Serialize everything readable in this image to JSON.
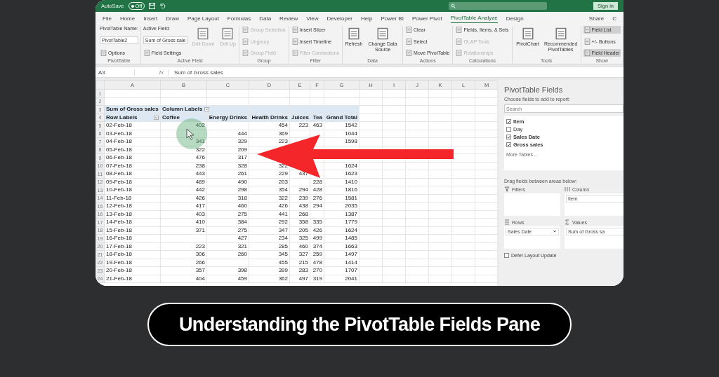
{
  "titlebar": {
    "autosave_label": "AutoSave",
    "autosave_state": "Off",
    "sign_in": "Sign in"
  },
  "tabs": [
    {
      "label": "File",
      "selected": false
    },
    {
      "label": "Home",
      "selected": false
    },
    {
      "label": "Insert",
      "selected": false
    },
    {
      "label": "Draw",
      "selected": false
    },
    {
      "label": "Page Layout",
      "selected": false
    },
    {
      "label": "Formulas",
      "selected": false
    },
    {
      "label": "Data",
      "selected": false
    },
    {
      "label": "Review",
      "selected": false
    },
    {
      "label": "View",
      "selected": false
    },
    {
      "label": "Developer",
      "selected": false
    },
    {
      "label": "Help",
      "selected": false
    },
    {
      "label": "Power BI",
      "selected": false
    },
    {
      "label": "Power Pivot",
      "selected": false
    },
    {
      "label": "PivotTable Analyze",
      "selected": true
    },
    {
      "label": "Design",
      "selected": false
    }
  ],
  "tab_actions": [
    "Share",
    "C"
  ],
  "ribbon": [
    {
      "label": "PivotTable",
      "items": [
        {
          "kind": "label",
          "text": "PivotTable Name:"
        },
        {
          "kind": "input",
          "text": "PivotTable2"
        },
        {
          "kind": "small",
          "text": "Options",
          "disabled": false
        }
      ]
    },
    {
      "label": "Active Field",
      "items": [
        {
          "kind": "label",
          "text": "Active Field:"
        },
        {
          "kind": "input",
          "text": "Sum of Gross sale"
        },
        {
          "kind": "small",
          "text": "Field Settings",
          "disabled": false
        },
        {
          "kind": "large",
          "text": "Drill Down",
          "disabled": true
        },
        {
          "kind": "large",
          "text": "Drill Up",
          "disabled": true
        }
      ]
    },
    {
      "label": "Group",
      "items": [
        {
          "kind": "small",
          "text": "Group Selection",
          "disabled": true
        },
        {
          "kind": "small",
          "text": "Ungroup",
          "disabled": true
        },
        {
          "kind": "small",
          "text": "Group Field",
          "disabled": true
        }
      ]
    },
    {
      "label": "Filter",
      "items": [
        {
          "kind": "small",
          "text": "Insert Slicer",
          "disabled": false
        },
        {
          "kind": "small",
          "text": "Insert Timeline",
          "disabled": false
        },
        {
          "kind": "small",
          "text": "Filter Connections",
          "disabled": true
        }
      ]
    },
    {
      "label": "Data",
      "items": [
        {
          "kind": "large",
          "text": "Refresh",
          "disabled": false
        },
        {
          "kind": "large",
          "text": "Change Data Source",
          "disabled": false
        }
      ]
    },
    {
      "label": "Actions",
      "items": [
        {
          "kind": "small",
          "text": "Clear",
          "disabled": false
        },
        {
          "kind": "small",
          "text": "Select",
          "disabled": false
        },
        {
          "kind": "small",
          "text": "Move PivotTable",
          "disabled": false
        }
      ]
    },
    {
      "label": "Calculations",
      "items": [
        {
          "kind": "small",
          "text": "Fields, Items, & Sets",
          "disabled": false
        },
        {
          "kind": "small",
          "text": "OLAP Tools",
          "disabled": true
        },
        {
          "kind": "small",
          "text": "Relationships",
          "disabled": true
        }
      ]
    },
    {
      "label": "Tools",
      "items": [
        {
          "kind": "large",
          "text": "PivotChart",
          "disabled": false
        },
        {
          "kind": "large",
          "text": "Recommended PivotTables",
          "disabled": false
        }
      ]
    },
    {
      "label": "Show",
      "items": [
        {
          "kind": "small",
          "text": "Field List",
          "disabled": false,
          "selected": true
        },
        {
          "kind": "small",
          "text": "+/- Buttons",
          "disabled": false,
          "selected": false
        },
        {
          "kind": "small",
          "text": "Field Header",
          "disabled": false,
          "selected": true
        }
      ]
    }
  ],
  "formula_bar": {
    "name_box": "A3",
    "fx_label": "fx",
    "formula": "Sum of Gross sales"
  },
  "sheet": {
    "columns": [
      "A",
      "B",
      "C",
      "D",
      "E",
      "F",
      "G",
      "H",
      "I",
      "J",
      "K",
      "L",
      "M"
    ],
    "rows": [
      {
        "number": "1",
        "kind": "blank",
        "cells": []
      },
      {
        "number": "2",
        "kind": "blank",
        "cells": []
      },
      {
        "number": "3",
        "kind": "pivot_header",
        "cells": [
          "Sum of Gross sales",
          "Column Labels"
        ]
      },
      {
        "number": "4",
        "kind": "pivot_labels",
        "cells": [
          "Row Labels",
          "Coffee",
          "Energy Drinks",
          "Health Drinks",
          "Juices",
          "Tea",
          "Grand Total"
        ]
      },
      {
        "number": "5",
        "kind": "data",
        "cells": [
          "02-Feb-18",
          "402",
          null,
          "454",
          "223",
          "463",
          "1542"
        ]
      },
      {
        "number": "6",
        "kind": "data",
        "cells": [
          "03-Feb-18",
          null,
          "444",
          "369",
          null,
          null,
          "1044"
        ]
      },
      {
        "number": "7",
        "kind": "data",
        "cells": [
          "04-Feb-18",
          "341",
          "329",
          "223",
          null,
          null,
          "1598"
        ]
      },
      {
        "number": "8",
        "kind": "data",
        "cells": [
          "05-Feb-18",
          "322",
          "209",
          null,
          null,
          null,
          null
        ]
      },
      {
        "number": "9",
        "kind": "data",
        "cells": [
          "06-Feb-18",
          "476",
          "317",
          null,
          null,
          null,
          null
        ]
      },
      {
        "number": "10",
        "kind": "data",
        "cells": [
          "07-Feb-18",
          "238",
          "328",
          "322",
          null,
          null,
          "1624"
        ]
      },
      {
        "number": "11",
        "kind": "data",
        "cells": [
          "08-Feb-18",
          "443",
          "261",
          "229",
          "437",
          null,
          "1623"
        ]
      },
      {
        "number": "12",
        "kind": "data",
        "cells": [
          "09-Feb-18",
          "489",
          "490",
          "203",
          null,
          "228",
          "1410"
        ]
      },
      {
        "number": "13",
        "kind": "data",
        "cells": [
          "10-Feb-18",
          "442",
          "298",
          "354",
          "294",
          "428",
          "1816"
        ]
      },
      {
        "number": "14",
        "kind": "data",
        "cells": [
          "11-Feb-18",
          "426",
          "318",
          "322",
          "239",
          "276",
          "1581"
        ]
      },
      {
        "number": "15",
        "kind": "data",
        "cells": [
          "12-Feb-18",
          "417",
          "460",
          "426",
          "438",
          "294",
          "2035"
        ]
      },
      {
        "number": "16",
        "kind": "data",
        "cells": [
          "13-Feb-18",
          "403",
          "275",
          "441",
          "268",
          null,
          "1387"
        ]
      },
      {
        "number": "17",
        "kind": "data",
        "cells": [
          "14-Feb-18",
          "410",
          "384",
          "292",
          "358",
          "335",
          "1779"
        ]
      },
      {
        "number": "18",
        "kind": "data",
        "cells": [
          "15-Feb-18",
          "371",
          "275",
          "347",
          "205",
          "426",
          "1624"
        ]
      },
      {
        "number": "19",
        "kind": "data",
        "cells": [
          "16-Feb-18",
          null,
          "427",
          "234",
          "325",
          "499",
          "1485"
        ]
      },
      {
        "number": "20",
        "kind": "data",
        "cells": [
          "17-Feb-18",
          "223",
          "321",
          "285",
          "460",
          "374",
          "1663"
        ]
      },
      {
        "number": "21",
        "kind": "data",
        "cells": [
          "18-Feb-18",
          "306",
          "260",
          "345",
          "327",
          "259",
          "1497"
        ]
      },
      {
        "number": "22",
        "kind": "data",
        "cells": [
          "19-Feb-18",
          "266",
          null,
          "455",
          "215",
          "478",
          "1414"
        ]
      },
      {
        "number": "23",
        "kind": "data",
        "cells": [
          "20-Feb-18",
          "357",
          "398",
          "399",
          "283",
          "270",
          "1707"
        ]
      },
      {
        "number": "24",
        "kind": "data",
        "cells": [
          "21-Feb-18",
          "404",
          "459",
          "362",
          "497",
          "319",
          "2041"
        ]
      }
    ]
  },
  "pane": {
    "title": "PivotTable Fields",
    "subtitle": "Choose fields to add to report:",
    "search_placeholder": "Search",
    "fields": [
      {
        "label": "Item",
        "checked": true
      },
      {
        "label": "Day",
        "checked": false
      },
      {
        "label": "Sales Date",
        "checked": true
      },
      {
        "label": "Gross sales",
        "checked": true
      }
    ],
    "more_tables": "More Tables...",
    "drag_hint": "Drag fields between areas below:",
    "areas": [
      {
        "label": "Filters",
        "kind": "filters"
      },
      {
        "label": "Column",
        "kind": "columns",
        "items": [
          "Item"
        ]
      },
      {
        "label": "Rows",
        "kind": "rows",
        "items": [
          "Sales Date"
        ]
      },
      {
        "label": "Values",
        "kind": "values",
        "items": [
          "Sum of Gross sa"
        ]
      }
    ],
    "defer_label": "Defer Layout Update",
    "defer_checked": false
  },
  "caption": "Understanding the PivotTable Fields Pane"
}
